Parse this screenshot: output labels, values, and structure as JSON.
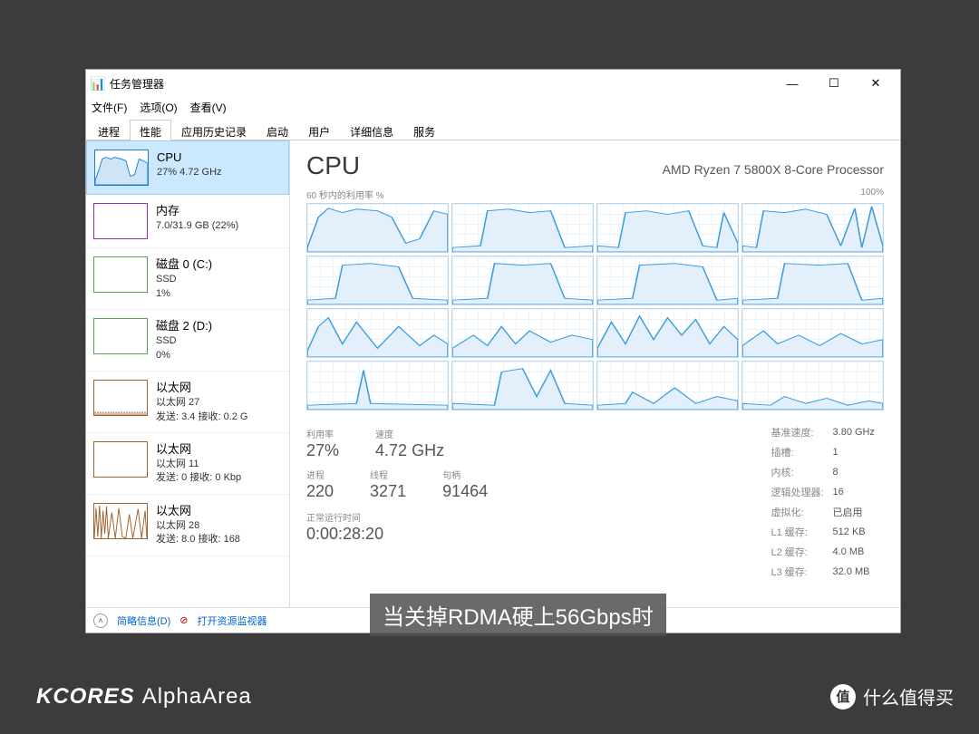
{
  "window": {
    "title": "任务管理器"
  },
  "menu": {
    "file": "文件(F)",
    "options": "选项(O)",
    "view": "查看(V)"
  },
  "tabs": [
    "进程",
    "性能",
    "应用历史记录",
    "启动",
    "用户",
    "详细信息",
    "服务"
  ],
  "sidebar": {
    "cpu": {
      "title": "CPU",
      "sub": "27% 4.72 GHz"
    },
    "mem": {
      "title": "内存",
      "sub": "7.0/31.9 GB (22%)"
    },
    "disk0": {
      "title": "磁盘 0 (C:)",
      "l1": "SSD",
      "l2": "1%"
    },
    "disk2": {
      "title": "磁盘 2 (D:)",
      "l1": "SSD",
      "l2": "0%"
    },
    "eth27": {
      "title": "以太网",
      "l1": "以太网 27",
      "l2": "发送: 3.4 接收: 0.2 G"
    },
    "eth11": {
      "title": "以太网",
      "l1": "以太网 11",
      "l2": "发送: 0 接收: 0 Kbp"
    },
    "eth28": {
      "title": "以太网",
      "l1": "以太网 28",
      "l2": "发送: 8.0 接收: 168"
    }
  },
  "detail": {
    "heading": "CPU",
    "model": "AMD Ryzen 7 5800X 8-Core Processor",
    "graph_label": "60 秒内的利用率 %",
    "graph_max": "100%",
    "util_lbl": "利用率",
    "util": "27%",
    "speed_lbl": "速度",
    "speed": "4.72 GHz",
    "proc_lbl": "进程",
    "proc": "220",
    "thread_lbl": "线程",
    "thread": "3271",
    "handle_lbl": "句柄",
    "handle": "91464",
    "uptime_lbl": "正常运行时间",
    "uptime": "0:00:28:20",
    "base_lbl": "基准速度:",
    "base": "3.80 GHz",
    "sockets_lbl": "插槽:",
    "sockets": "1",
    "cores_lbl": "内核:",
    "cores": "8",
    "logical_lbl": "逻辑处理器:",
    "logical": "16",
    "virt_lbl": "虚拟化:",
    "virt": "已启用",
    "l1_lbl": "L1 缓存:",
    "l1": "512 KB",
    "l2_lbl": "L2 缓存:",
    "l2": "4.0 MB",
    "l3_lbl": "L3 缓存:",
    "l3": "32.0 MB"
  },
  "footer": {
    "brief": "简略信息(D)",
    "resmon": "打开资源监视器"
  },
  "caption": "当关掉RDMA硬上56Gbps时",
  "brand1": "KCORES",
  "brand2": "AlphaArea",
  "smzdm": "什么值得买"
}
